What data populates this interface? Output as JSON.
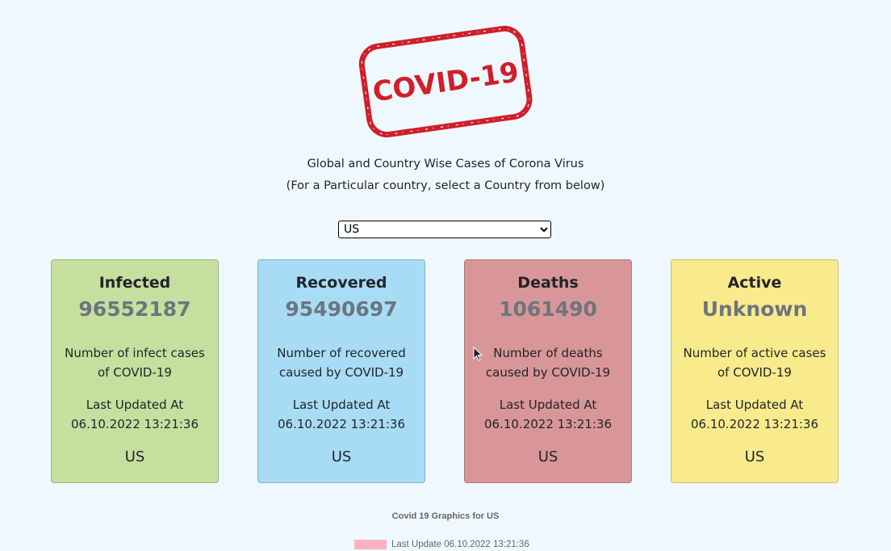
{
  "logo": {
    "text": "COVID-19",
    "color": "#d01f2a"
  },
  "header": {
    "line1": "Global and Country Wise Cases of Corona Virus",
    "line2": "(For a Particular country, select a Country from below)"
  },
  "country_select": {
    "selected": "US"
  },
  "cards": [
    {
      "title": "Infected",
      "value": "96552187",
      "description": "Number of infect cases of COVID-19",
      "updated_label": "Last Updated At",
      "updated_time": "06.10.2022 13:21:36",
      "country": "US",
      "color": "#c5df9f"
    },
    {
      "title": "Recovered",
      "value": "95490697",
      "description": "Number of recovered caused by COVID-19",
      "updated_label": "Last Updated At",
      "updated_time": "06.10.2022 13:21:36",
      "country": "US",
      "color": "#a8dcf5"
    },
    {
      "title": "Deaths",
      "value": "1061490",
      "description": "Number of deaths caused by COVID-19",
      "updated_label": "Last Updated At",
      "updated_time": "06.10.2022 13:21:36",
      "country": "US",
      "color": "#d99698"
    },
    {
      "title": "Active",
      "value": "Unknown",
      "description": "Number of active cases of COVID-19",
      "updated_label": "Last Updated At",
      "updated_time": "06.10.2022 13:21:36",
      "country": "US",
      "color": "#f9ea8c"
    }
  ],
  "chart": {
    "title": "Covid 19 Graphics for US",
    "legend_label": "Last Update 06.10.2022 13:21:36",
    "legend_color": "#ffb1c1"
  }
}
